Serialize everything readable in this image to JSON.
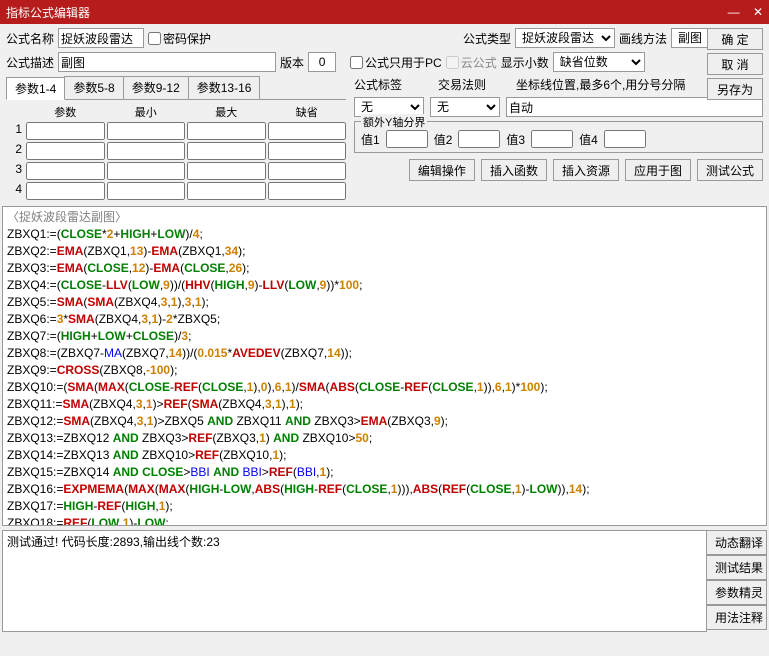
{
  "window": {
    "title": "指标公式编辑器",
    "min": "—",
    "close": "✕"
  },
  "labels": {
    "name": "公式名称",
    "pwd": "密码保护",
    "type": "公式类型",
    "drawmethod": "画线方法",
    "desc": "公式描述",
    "ver": "版本",
    "pconly": "公式只用于PC",
    "cloud": "云公式",
    "showdec": "显示小数",
    "defdigits": "缺省位数",
    "tag": "公式标签",
    "law": "交易法则",
    "axispos": "坐标线位置,最多6个,用分号分隔",
    "yextra": "额外Y轴分界",
    "v1": "值1",
    "v2": "值2",
    "v3": "值3",
    "v4": "值4"
  },
  "vals": {
    "name": "捉妖波段雷达",
    "type": "捉妖波段雷达",
    "drawmethod": "副图",
    "desc": "副图",
    "ver": "0",
    "defdigits": "缺省位数",
    "tag": "无",
    "law": "无",
    "axispos": "自动"
  },
  "buttons": {
    "ok": "确 定",
    "cancel": "取 消",
    "saveas": "另存为",
    "editop": "编辑操作",
    "insfn": "插入函数",
    "insres": "插入资源",
    "apply": "应用于图",
    "test": "测试公式",
    "dyntrans": "动态翻译",
    "testres": "测试结果",
    "paramwiz": "参数精灵",
    "usage": "用法注释"
  },
  "paramtabs": [
    "参数1-4",
    "参数5-8",
    "参数9-12",
    "参数13-16"
  ],
  "paramhdr": [
    "参数",
    "最小",
    "最大",
    "缺省"
  ],
  "rows": [
    "1",
    "2",
    "3",
    "4"
  ],
  "codetitle": "〈捉妖波段雷达副图〉",
  "status": "测试通过! 代码长度:2893,输出线个数:23"
}
